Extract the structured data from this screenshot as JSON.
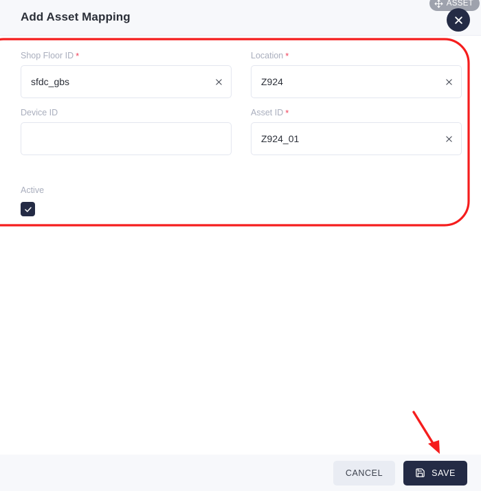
{
  "header": {
    "title": "Add Asset Mapping",
    "badge": {
      "label": "ASSET",
      "icon": "move-icon"
    },
    "close_icon": "close-icon"
  },
  "form": {
    "fields": [
      {
        "label": "Shop Floor ID",
        "required": true,
        "value": "sfdc_gbs",
        "placeholder": "",
        "has_clear": true,
        "clear_icon": "clear-icon"
      },
      {
        "label": "Location",
        "required": true,
        "value": "Z924",
        "placeholder": "",
        "has_clear": true,
        "clear_icon": "clear-icon"
      },
      {
        "label": "Device ID",
        "required": false,
        "value": "",
        "placeholder": "",
        "has_clear": false,
        "clear_icon": ""
      },
      {
        "label": "Asset ID",
        "required": true,
        "value": "Z924_01",
        "placeholder": "",
        "has_clear": true,
        "clear_icon": "clear-icon"
      }
    ],
    "active": {
      "label": "Active",
      "checked": true,
      "check_icon": "check-icon"
    },
    "required_marker": "*"
  },
  "footer": {
    "cancel_label": "CANCEL",
    "save_label": "SAVE",
    "save_icon": "save-floppy-icon"
  },
  "annotations": {
    "highlight_color": "#f51d1d",
    "arrow_color": "#f51d1d"
  },
  "colors": {
    "primary_dark": "#242b45",
    "header_bg": "#f7f8fb",
    "required_red": "#f0415a",
    "label_gray": "#a9aebd",
    "badge_gray": "#9ea2ad"
  }
}
